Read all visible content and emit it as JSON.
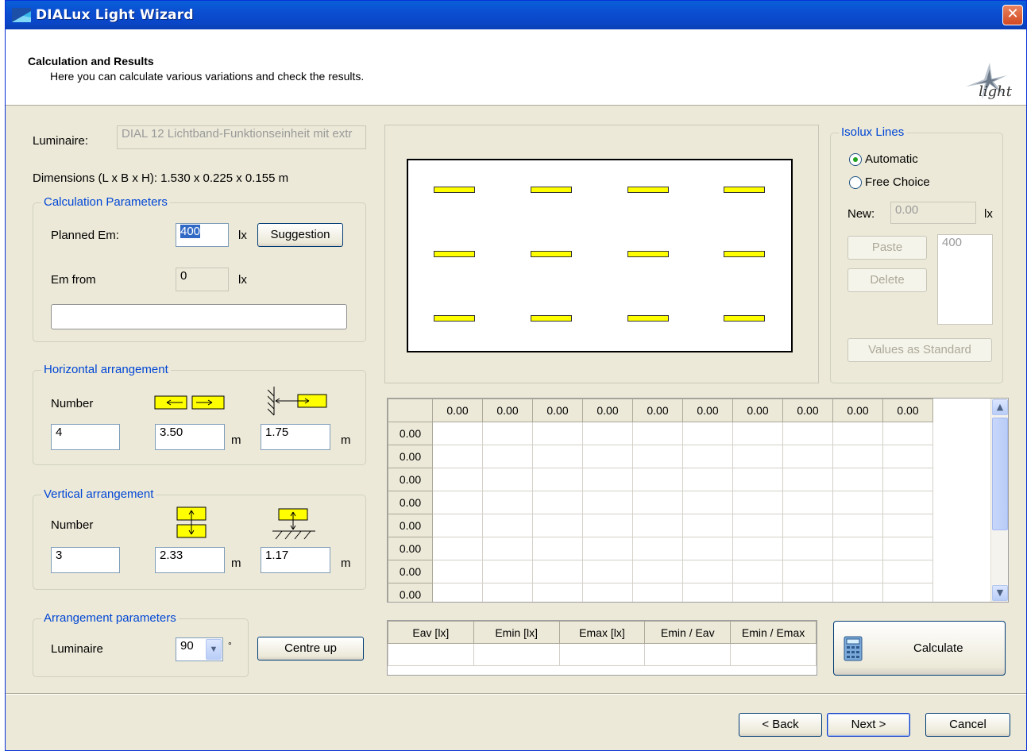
{
  "window": {
    "title": "DIALux Light Wizard",
    "close_label": "✕"
  },
  "header": {
    "title": "Calculation and Results",
    "subtitle": "Here you can calculate various variations and check the results.",
    "logo_text": "light"
  },
  "luminaire": {
    "label": "Luminaire:",
    "value": "DIAL 12 Lichtband-Funktionseinheit mit extr",
    "dimensions": "Dimensions (L x B x H): 1.530 x 0.225 x 0.155 m"
  },
  "calc_params": {
    "legend": "Calculation Parameters",
    "planned_em_label": "Planned Em:",
    "planned_em_value": "400",
    "unit_lx": "lx",
    "suggestion_label": "Suggestion",
    "em_from_label": "Em from",
    "em_from_value": "0",
    "progress_value": ""
  },
  "horizontal": {
    "legend": "Horizontal arrangement",
    "number_label": "Number",
    "number": "4",
    "spacing": "3.50",
    "wall_distance": "1.75",
    "unit_m": "m"
  },
  "vertical": {
    "legend": "Vertical arrangement",
    "number_label": "Number",
    "number": "3",
    "spacing": "2.33",
    "wall_distance": "1.17",
    "unit_m": "m"
  },
  "arrangement": {
    "legend": "Arrangement parameters",
    "luminaire_label": "Luminaire",
    "angle": "90",
    "degree": "°",
    "centre_up_label": "Centre up"
  },
  "layout_preview": {
    "columns": 4,
    "rows": 3,
    "luminaire_color": "#ffff00"
  },
  "isolux": {
    "legend": "Isolux Lines",
    "automatic_label": "Automatic",
    "automatic_selected": true,
    "free_choice_label": "Free Choice",
    "new_label": "New:",
    "new_value": "0.00",
    "unit": "lx",
    "paste_label": "Paste",
    "delete_label": "Delete",
    "list_value": "400",
    "values_standard_label": "Values as Standard"
  },
  "grid": {
    "col_headers": [
      "0.00",
      "0.00",
      "0.00",
      "0.00",
      "0.00",
      "0.00",
      "0.00",
      "0.00",
      "0.00",
      "0.00"
    ],
    "row_headers": [
      "0.00",
      "0.00",
      "0.00",
      "0.00",
      "0.00",
      "0.00",
      "0.00",
      "0.00"
    ],
    "scroll_up": "▲",
    "scroll_down": "▼"
  },
  "results": {
    "headers": [
      "Eav [lx]",
      "Emin [lx]",
      "Emax [lx]",
      "Emin / Eav",
      "Emin / Emax"
    ],
    "values": [
      "",
      "",
      "",
      "",
      ""
    ]
  },
  "calculate_label": "Calculate",
  "footer": {
    "back_label": "< Back",
    "next_label": "Next >",
    "cancel_label": "Cancel"
  }
}
